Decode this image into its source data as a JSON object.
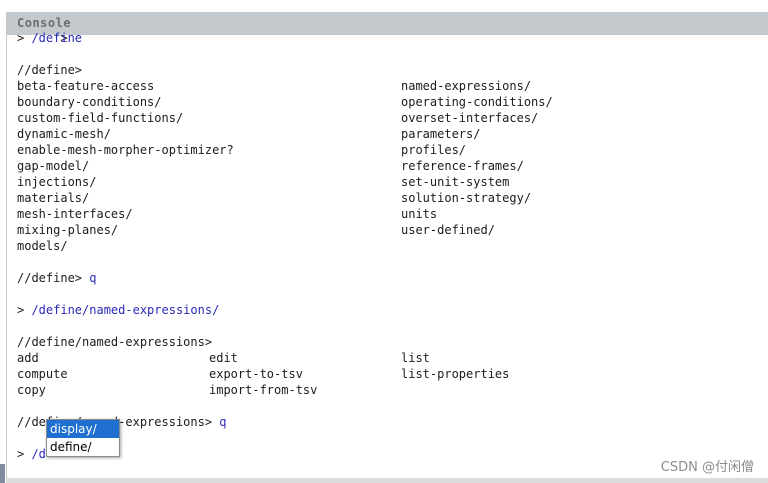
{
  "title": "Console",
  "lines": {
    "l0": "> ",
    "l1_prompt": "> ",
    "l1_cmd": "/define",
    "l3": "//define>",
    "menu_left": [
      "beta-feature-access",
      "boundary-conditions/",
      "custom-field-functions/",
      "dynamic-mesh/",
      "enable-mesh-morpher-optimizer?",
      "gap-model/",
      "injections/",
      "materials/",
      "mesh-interfaces/",
      "mixing-planes/",
      "models/"
    ],
    "menu_right": [
      "named-expressions/",
      "operating-conditions/",
      "overset-interfaces/",
      "parameters/",
      "profiles/",
      "reference-frames/",
      "set-unit-system",
      "solution-strategy/",
      "units",
      "user-defined/",
      ""
    ],
    "l16_prompt": "//define> ",
    "l16_cmd": "q",
    "l18_prompt": "> ",
    "l18_cmd": "/define/named-expressions/",
    "l20": "//define/named-expressions>",
    "ne_c1": [
      "add",
      "compute",
      "copy"
    ],
    "ne_c2": [
      "edit",
      "export-to-tsv",
      "import-from-tsv"
    ],
    "ne_c3": [
      "list",
      "list-properties",
      ""
    ],
    "l25_prompt": "//define/named-expressions> ",
    "l25_cmd": "q",
    "l27_prompt": "> ",
    "l27_cmd": "/d"
  },
  "autocomplete": [
    "display/",
    "define/"
  ],
  "watermark": "CSDN @付闲僧",
  "colors": {
    "command": "#2a2ab8",
    "selection": "#1f6fd1",
    "titlebar": "#c4c9ce"
  }
}
